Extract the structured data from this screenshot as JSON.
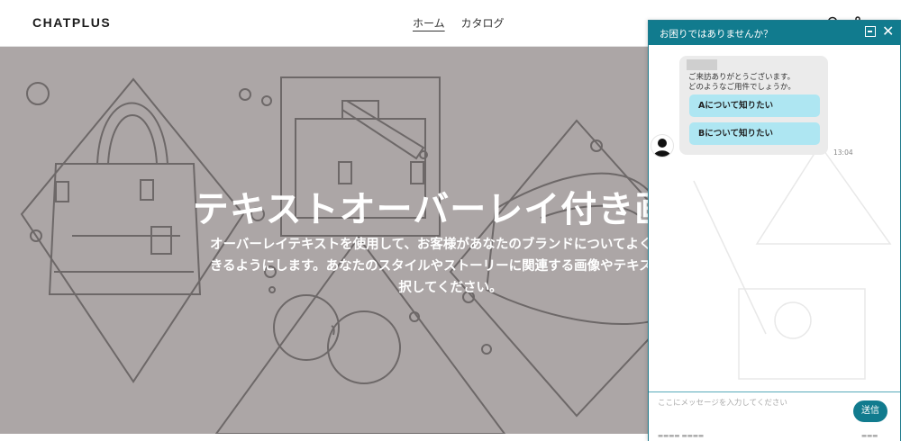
{
  "header": {
    "logo": "CHATPLUS",
    "nav": [
      {
        "label": "ホーム",
        "active": true
      },
      {
        "label": "カタログ",
        "active": false
      }
    ],
    "icons": [
      "search-icon",
      "cart-icon"
    ]
  },
  "hero": {
    "title": "テキストオーバーレイ付き画像",
    "text": "オーバーレイテキストを使用して、お客様があなたのブランドについてよく理解できるようにします。あなたのスタイルやストーリーに関連する画像やテキストを選択してください。",
    "background_color": "#aca6a6"
  },
  "chat": {
    "title": "お困りではありませんか？",
    "message_line1": "ご来訪ありがとうございます。",
    "message_line2": "どのようなご用件でしょうか。",
    "options": [
      "Aについて知りたい",
      "Bについて知りたい"
    ],
    "time": "13:04",
    "input_placeholder": "ここにメッセージを入力してください",
    "send_label": "送信",
    "accent_color": "#117b8e",
    "option_color": "#aee6f2"
  }
}
